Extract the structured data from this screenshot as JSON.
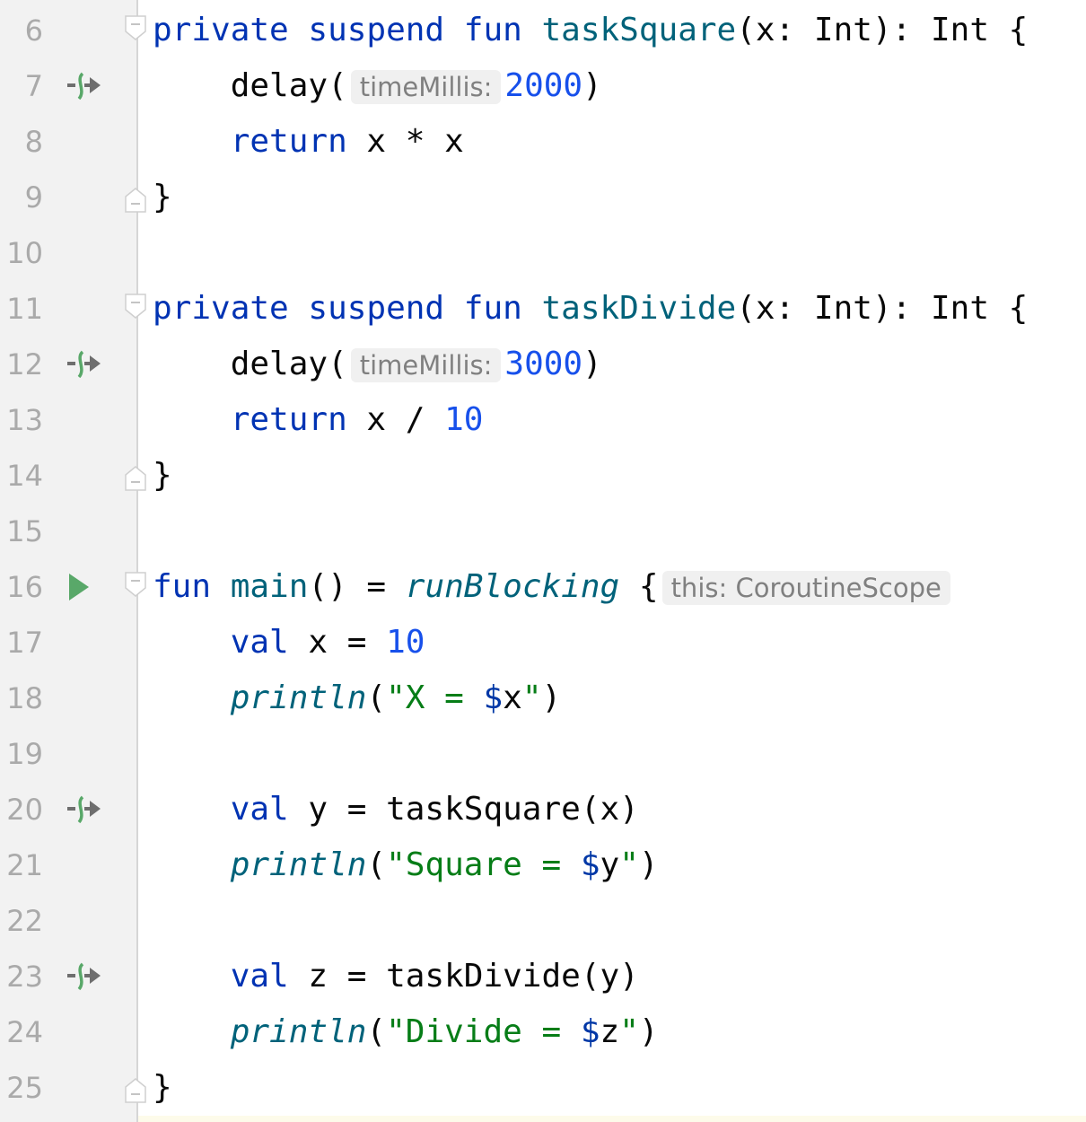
{
  "colors": {
    "keyword": "#0033b3",
    "function": "#00627a",
    "number": "#1750eb",
    "string": "#067d17",
    "line_number": "#aaaaaa",
    "gutter_icon": "#59a869"
  },
  "lines": [
    {
      "n": "6",
      "icon": "",
      "fold": "start",
      "segs": [
        [
          "kw",
          "private suspend fun "
        ],
        [
          "fn",
          "taskSquare"
        ],
        [
          "",
          "(x: Int): Int {"
        ]
      ]
    },
    {
      "n": "7",
      "icon": "suspend-call-icon",
      "fold": "",
      "segs": [
        [
          "",
          "    delay("
        ],
        [
          "hint",
          "timeMillis:"
        ],
        [
          "num",
          "2000"
        ],
        [
          "",
          ")"
        ]
      ]
    },
    {
      "n": "8",
      "icon": "",
      "fold": "",
      "segs": [
        [
          "kw",
          "    return "
        ],
        [
          "",
          "x * x"
        ]
      ]
    },
    {
      "n": "9",
      "icon": "",
      "fold": "end",
      "segs": [
        [
          "",
          "}"
        ]
      ]
    },
    {
      "n": "10",
      "icon": "",
      "fold": "",
      "segs": []
    },
    {
      "n": "11",
      "icon": "",
      "fold": "start",
      "segs": [
        [
          "kw",
          "private suspend fun "
        ],
        [
          "fn",
          "taskDivide"
        ],
        [
          "",
          "(x: Int): Int {"
        ]
      ]
    },
    {
      "n": "12",
      "icon": "suspend-call-icon",
      "fold": "",
      "segs": [
        [
          "",
          "    delay("
        ],
        [
          "hint",
          "timeMillis:"
        ],
        [
          "num",
          "3000"
        ],
        [
          "",
          ")"
        ]
      ]
    },
    {
      "n": "13",
      "icon": "",
      "fold": "",
      "segs": [
        [
          "kw",
          "    return "
        ],
        [
          "",
          "x / "
        ],
        [
          "num",
          "10"
        ]
      ]
    },
    {
      "n": "14",
      "icon": "",
      "fold": "end",
      "segs": [
        [
          "",
          "}"
        ]
      ]
    },
    {
      "n": "15",
      "icon": "",
      "fold": "",
      "segs": []
    },
    {
      "n": "16",
      "icon": "run-icon",
      "fold": "start",
      "segs": [
        [
          "kw",
          "fun "
        ],
        [
          "fn",
          "main"
        ],
        [
          "",
          "() = "
        ],
        [
          "it",
          "runBlocking"
        ],
        [
          "",
          " {"
        ],
        [
          "hint",
          "this: CoroutineScope"
        ]
      ]
    },
    {
      "n": "17",
      "icon": "",
      "fold": "",
      "segs": [
        [
          "kw",
          "    val "
        ],
        [
          "",
          "x = "
        ],
        [
          "num",
          "10"
        ]
      ]
    },
    {
      "n": "18",
      "icon": "",
      "fold": "",
      "segs": [
        [
          "it",
          "    println"
        ],
        [
          "",
          "("
        ],
        [
          "str",
          "\"X = "
        ],
        [
          "tpl",
          "$"
        ],
        [
          "",
          "x"
        ],
        [
          "str",
          "\""
        ],
        [
          "",
          ")"
        ]
      ]
    },
    {
      "n": "19",
      "icon": "",
      "fold": "",
      "segs": []
    },
    {
      "n": "20",
      "icon": "suspend-call-icon",
      "fold": "",
      "segs": [
        [
          "kw",
          "    val "
        ],
        [
          "",
          "y = taskSquare(x)"
        ]
      ]
    },
    {
      "n": "21",
      "icon": "",
      "fold": "",
      "segs": [
        [
          "it",
          "    println"
        ],
        [
          "",
          "("
        ],
        [
          "str",
          "\"Square = "
        ],
        [
          "tpl",
          "$"
        ],
        [
          "",
          "y"
        ],
        [
          "str",
          "\""
        ],
        [
          "",
          ")"
        ]
      ]
    },
    {
      "n": "22",
      "icon": "",
      "fold": "",
      "segs": []
    },
    {
      "n": "23",
      "icon": "suspend-call-icon",
      "fold": "",
      "segs": [
        [
          "kw",
          "    val "
        ],
        [
          "",
          "z = taskDivide(y)"
        ]
      ]
    },
    {
      "n": "24",
      "icon": "",
      "fold": "",
      "segs": [
        [
          "it",
          "    println"
        ],
        [
          "",
          "("
        ],
        [
          "str",
          "\"Divide = "
        ],
        [
          "tpl",
          "$"
        ],
        [
          "",
          "z"
        ],
        [
          "str",
          "\""
        ],
        [
          "",
          ")"
        ]
      ]
    },
    {
      "n": "25",
      "icon": "",
      "fold": "end",
      "segs": [
        [
          "",
          "}"
        ]
      ]
    }
  ]
}
